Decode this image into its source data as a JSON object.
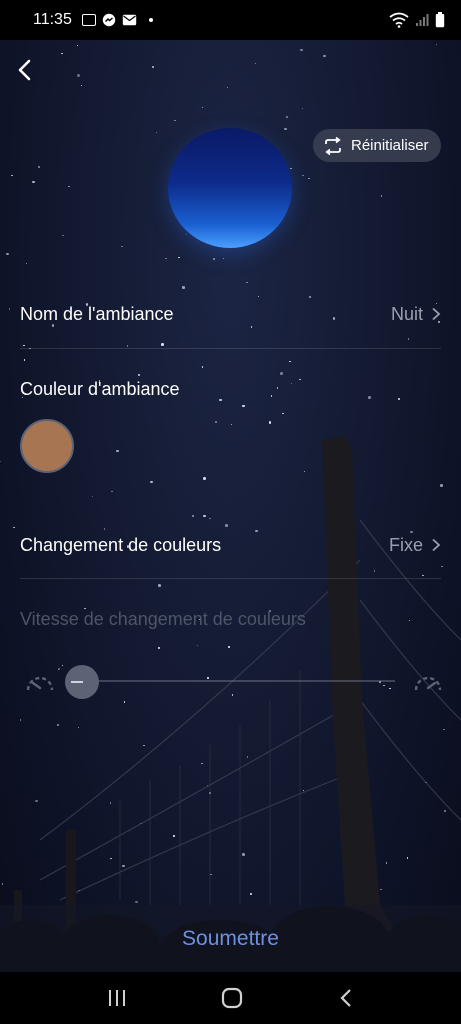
{
  "status_bar": {
    "time": "11:35"
  },
  "header": {
    "back_icon": "chevron-left-icon",
    "reset_label": "Réinitialiser",
    "reset_icon": "refresh-icon"
  },
  "settings": {
    "ambiance_name_label": "Nom de l'ambiance",
    "ambiance_name_value": "Nuit",
    "ambiance_color_label": "Couleur d'ambiance",
    "ambiance_color_hex": "#a87553",
    "color_change_label": "Changement de couleurs",
    "color_change_value": "Fixe",
    "speed_label": "Vitesse de changement de couleurs",
    "speed_level": 0.0
  },
  "footer": {
    "submit_label": "Soumettre"
  },
  "colors": {
    "accent": "#6f8fe0",
    "orb_top": "#0a1a66",
    "orb_bottom": "#4aa0ff"
  }
}
